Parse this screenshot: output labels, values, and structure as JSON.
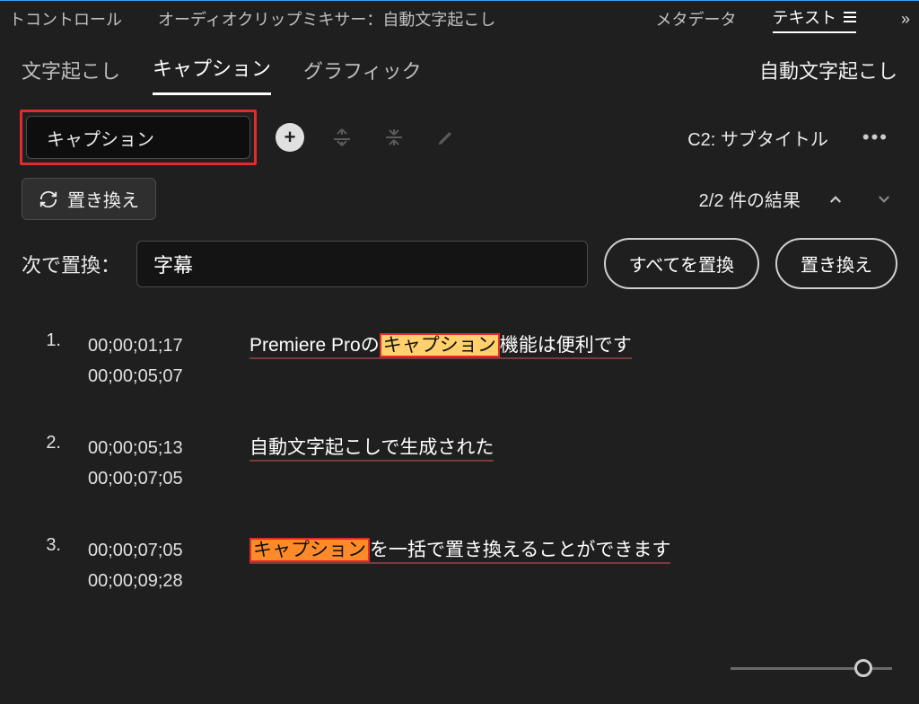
{
  "topTabs": {
    "items": [
      "トコントロール",
      "オーディオクリップミキサー：自動文字起こし",
      "メタデータ"
    ],
    "activeTab": "テキスト"
  },
  "subTabs": {
    "items": [
      "文字起こし",
      "キャプション",
      "グラフィック"
    ],
    "activeIndex": 1,
    "rightLabel": "自動文字起こし"
  },
  "search": {
    "value": "キャプション"
  },
  "trackLabel": "C2: サブタイトル",
  "replace": {
    "toggleLabel": "置き換え",
    "resultsText": "2/2 件の結果",
    "withLabel": "次で置換：",
    "withValue": "字幕",
    "replaceAll": "すべてを置換",
    "replaceOne": "置き換え"
  },
  "captions": [
    {
      "num": "1.",
      "in": "00;00;01;17",
      "out": "00;00;05;07",
      "pre": "Premiere Proの",
      "match": "キャプション",
      "post": "機能は便利です",
      "highlight": "nosel"
    },
    {
      "num": "2.",
      "in": "00;00;05;13",
      "out": "00;00;07;05",
      "pre": "自動文字起こしで生成された",
      "match": "",
      "post": "",
      "highlight": "none"
    },
    {
      "num": "3.",
      "in": "00;00;07;05",
      "out": "00;00;09;28",
      "pre": "",
      "match": "キャプション",
      "post": "を一括で置き換えることができます",
      "highlight": "sel"
    }
  ]
}
